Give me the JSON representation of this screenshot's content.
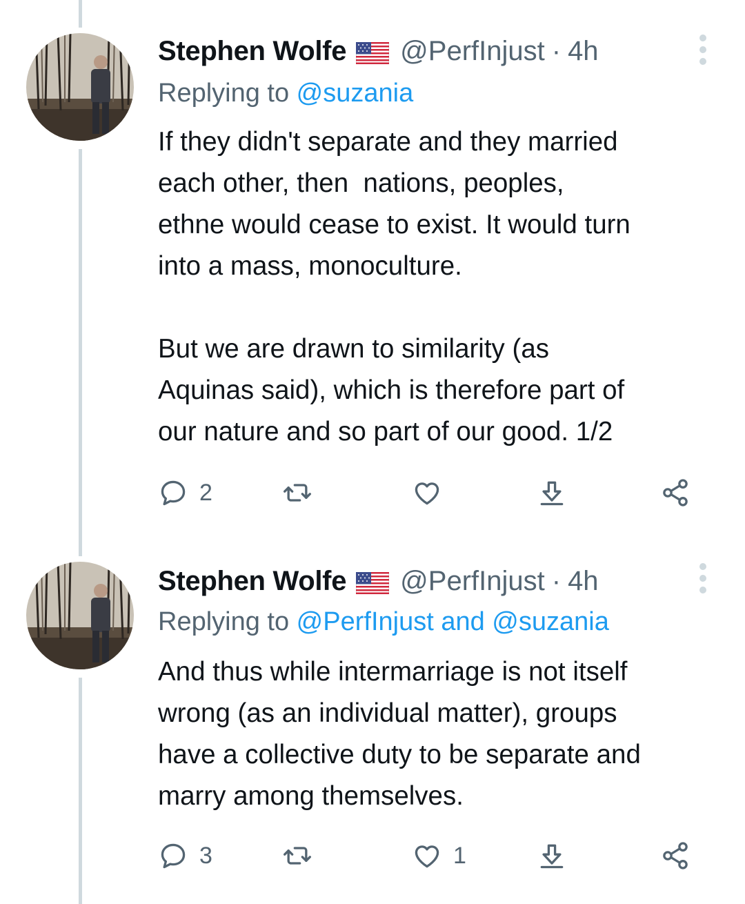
{
  "tweets": [
    {
      "name": "Stephen Wolfe",
      "flag": "us-flag-emoji",
      "handle": "@PerfInjust",
      "dot": "·",
      "time": "4h",
      "replying_prefix": "Replying to ",
      "replying_to": "@suzania",
      "text": "If they didn't separate and they married\neach other, then  nations, peoples,\nethne would cease to exist. It would turn\ninto a mass, monoculture.\n\nBut we are drawn to similarity (as\nAquinas said), which is therefore part of\nour nature and so part of our good. 1/2",
      "replies": "2",
      "retweets": "",
      "likes": "",
      "icons": [
        "reply-icon",
        "retweet-icon",
        "like-icon",
        "download-icon",
        "share-icon"
      ]
    },
    {
      "name": "Stephen Wolfe",
      "flag": "us-flag-emoji",
      "handle": "@PerfInjust",
      "dot": "·",
      "time": "4h",
      "replying_prefix": "Replying to ",
      "replying_to": "@PerfInjust and @suzania",
      "text": "And thus while intermarriage is not itself\nwrong (as an individual matter), groups\nhave a collective duty to be separate and\nmarry among themselves.",
      "replies": "3",
      "retweets": "",
      "likes": "1",
      "icons": [
        "reply-icon",
        "retweet-icon",
        "like-icon",
        "download-icon",
        "share-icon"
      ]
    }
  ],
  "colors": {
    "text": "#0f1419",
    "secondary": "#536471",
    "link": "#1d9bf0",
    "thread_line": "#cfd9de"
  }
}
